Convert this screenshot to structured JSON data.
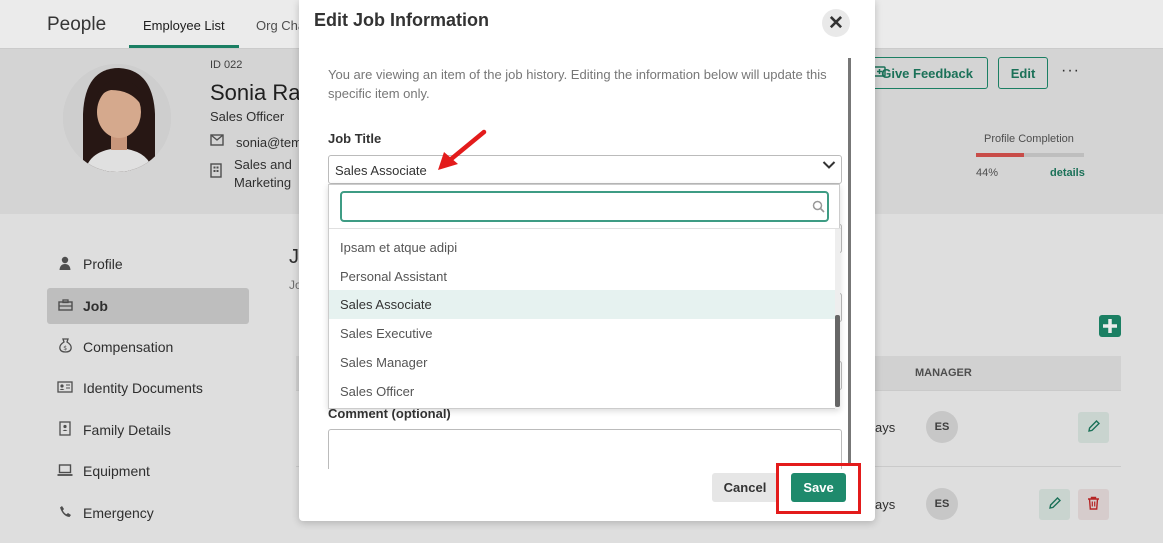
{
  "app": {
    "title": "People",
    "tabs": [
      {
        "label": "Employee List",
        "active": true
      },
      {
        "label": "Org Cha",
        "active": false
      }
    ]
  },
  "employee": {
    "id": "ID 022",
    "name": "Sonia Rag",
    "role": "Sales Officer",
    "email": "sonia@tem",
    "department": "Sales and Marketing"
  },
  "actions": {
    "feedback": "Give Feedback",
    "edit": "Edit",
    "more": "···"
  },
  "profile_completion": {
    "label": "Profile Completion",
    "percent_text": "44%",
    "value": 0.44,
    "details": "details",
    "bar_color": "#d9534f"
  },
  "sidebar": {
    "items": [
      {
        "label": "Profile",
        "icon": "person-icon",
        "active": false
      },
      {
        "label": "Job",
        "icon": "briefcase-icon",
        "active": true
      },
      {
        "label": "Compensation",
        "icon": "money-bag-icon",
        "active": false
      },
      {
        "label": "Identity Documents",
        "icon": "id-card-icon",
        "active": false
      },
      {
        "label": "Family Details",
        "icon": "family-book-icon",
        "active": false
      },
      {
        "label": "Equipment",
        "icon": "laptop-icon",
        "active": false
      },
      {
        "label": "Emergency",
        "icon": "phone-icon",
        "active": false
      }
    ]
  },
  "main": {
    "heading": "J",
    "subheading": "Jo",
    "table": {
      "manager_header": "MANAGER",
      "rows": [
        {
          "duration": "ays",
          "manager": "ES"
        },
        {
          "duration": "ays",
          "manager": "ES"
        }
      ]
    }
  },
  "modal": {
    "title": "Edit Job Information",
    "close": "✕",
    "intro": "You are viewing an item of the job history. Editing the information below will update this specific item only.",
    "job_title_label": "Job Title",
    "job_title_value": "Sales Associate",
    "search_value": "",
    "options": [
      {
        "label": "Ipsam et atque adipi",
        "selected": false
      },
      {
        "label": "Personal Assistant",
        "selected": false
      },
      {
        "label": "Sales Associate",
        "selected": true
      },
      {
        "label": "Sales Executive",
        "selected": false
      },
      {
        "label": "Sales Manager",
        "selected": false
      },
      {
        "label": "Sales Officer",
        "selected": false
      }
    ],
    "comment_label": "Comment (optional)",
    "comment_value": "",
    "cancel": "Cancel",
    "save": "Save"
  },
  "colors": {
    "accent": "#1e8a6c",
    "annotation": "#e31b1b"
  }
}
